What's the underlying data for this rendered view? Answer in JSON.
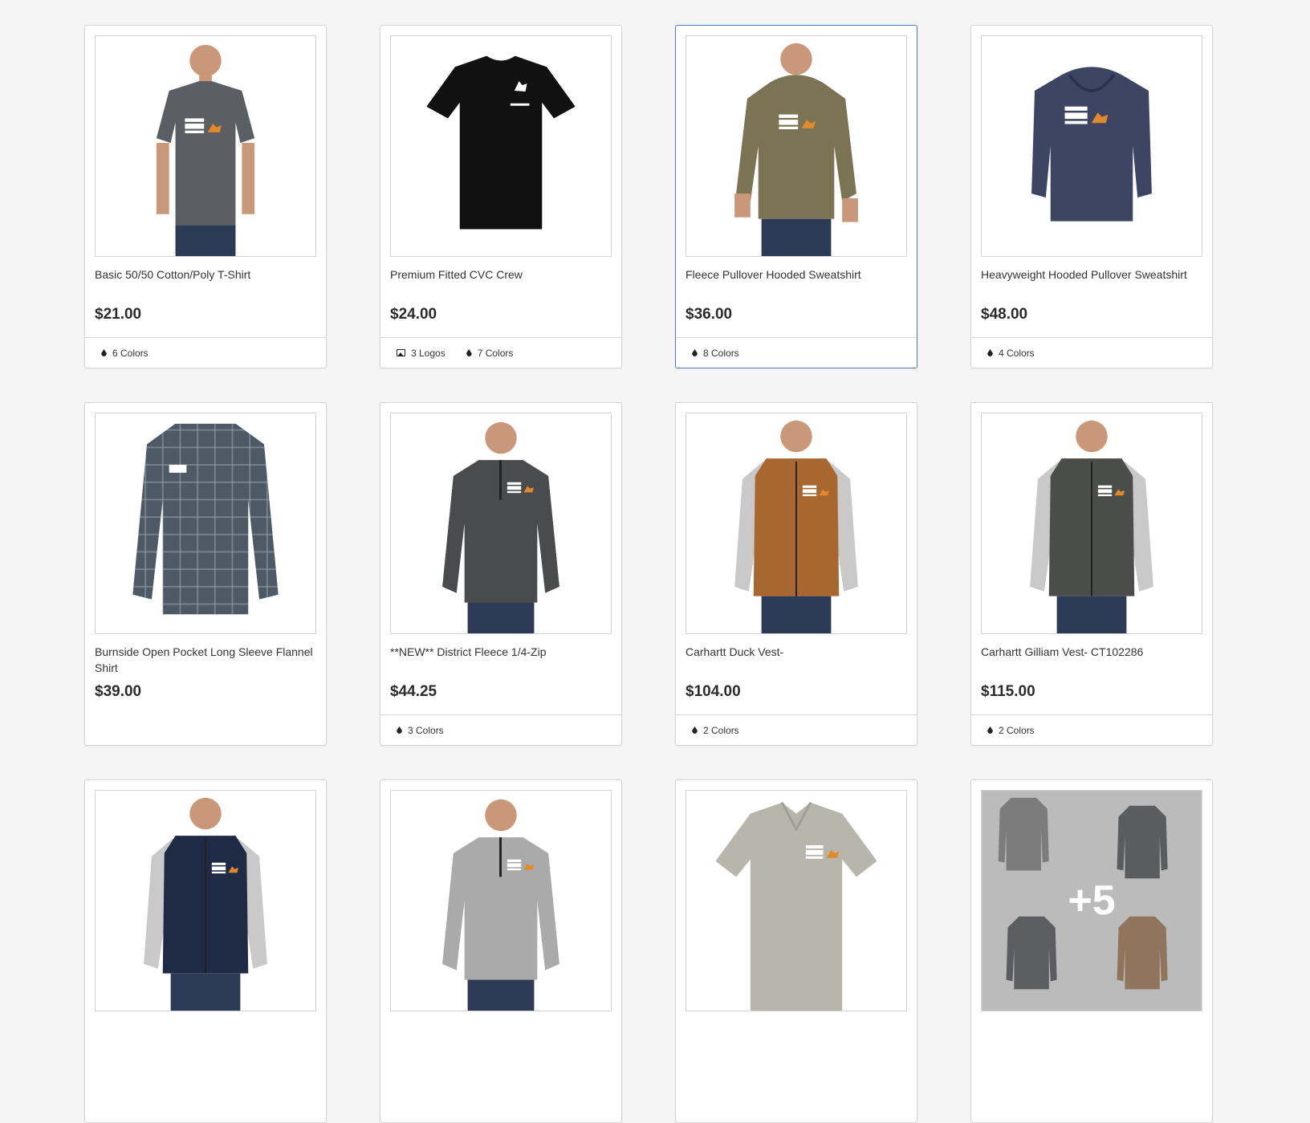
{
  "colors": {
    "selected_border": "#4a7ec2",
    "accent_orange": "#e08a2c"
  },
  "products": [
    {
      "name": "Basic 50/50 Cotton/Poly T-Shirt",
      "price": "$21.00",
      "tags": [
        {
          "icon": "droplet-icon",
          "text": "6 Colors"
        }
      ],
      "garment": "tshirt",
      "color": "#5b5e62",
      "selected": false
    },
    {
      "name": "Premium Fitted CVC Crew",
      "price": "$24.00",
      "tags": [
        {
          "icon": "image-icon",
          "text": "3 Logos"
        },
        {
          "icon": "droplet-icon",
          "text": "7 Colors"
        }
      ],
      "garment": "tshirt-flat",
      "color": "#111111",
      "selected": false
    },
    {
      "name": "Fleece Pullover Hooded Sweatshirt",
      "price": "$36.00",
      "tags": [
        {
          "icon": "droplet-icon",
          "text": "8 Colors"
        }
      ],
      "garment": "hoodie",
      "color": "#7a7354",
      "selected": true
    },
    {
      "name": "Heavyweight Hooded Pullover Sweatshirt",
      "price": "$48.00",
      "tags": [
        {
          "icon": "droplet-icon",
          "text": "4 Colors"
        }
      ],
      "garment": "hoodie-flat",
      "color": "#3e4563",
      "selected": false
    },
    {
      "name": "Burnside Open Pocket Long Sleeve Flannel Shirt",
      "price": "$39.00",
      "tags": [],
      "garment": "flannel",
      "color": "#4d5a66",
      "selected": false
    },
    {
      "name": "**NEW** District Fleece 1/4-Zip",
      "price": "$44.25",
      "tags": [
        {
          "icon": "droplet-icon",
          "text": "3 Colors"
        }
      ],
      "garment": "quarterzip",
      "color": "#4a4b4c",
      "selected": false
    },
    {
      "name": "Carhartt Duck Vest-",
      "price": "$104.00",
      "tags": [
        {
          "icon": "droplet-icon",
          "text": "2 Colors"
        }
      ],
      "garment": "vest",
      "color": "#a8672f",
      "selected": false
    },
    {
      "name": "Carhartt Gilliam Vest- CT102286",
      "price": "$115.00",
      "tags": [
        {
          "icon": "droplet-icon",
          "text": "2 Colors"
        }
      ],
      "garment": "vest",
      "color": "#4a4d4a",
      "selected": false
    },
    {
      "name": "",
      "price": "",
      "tags": [],
      "garment": "vest",
      "color": "#1f2a44",
      "selected": false
    },
    {
      "name": "",
      "price": "",
      "tags": [],
      "garment": "quarterzip",
      "color": "#a9aaa9",
      "selected": false
    },
    {
      "name": "",
      "price": "",
      "tags": [],
      "garment": "polo",
      "color": "#b8b6ac",
      "selected": false
    },
    {
      "name": "",
      "price": "",
      "tags": [],
      "garment": "collage",
      "color": "#6a6a6a",
      "selected": false,
      "more_label": "+5"
    }
  ]
}
